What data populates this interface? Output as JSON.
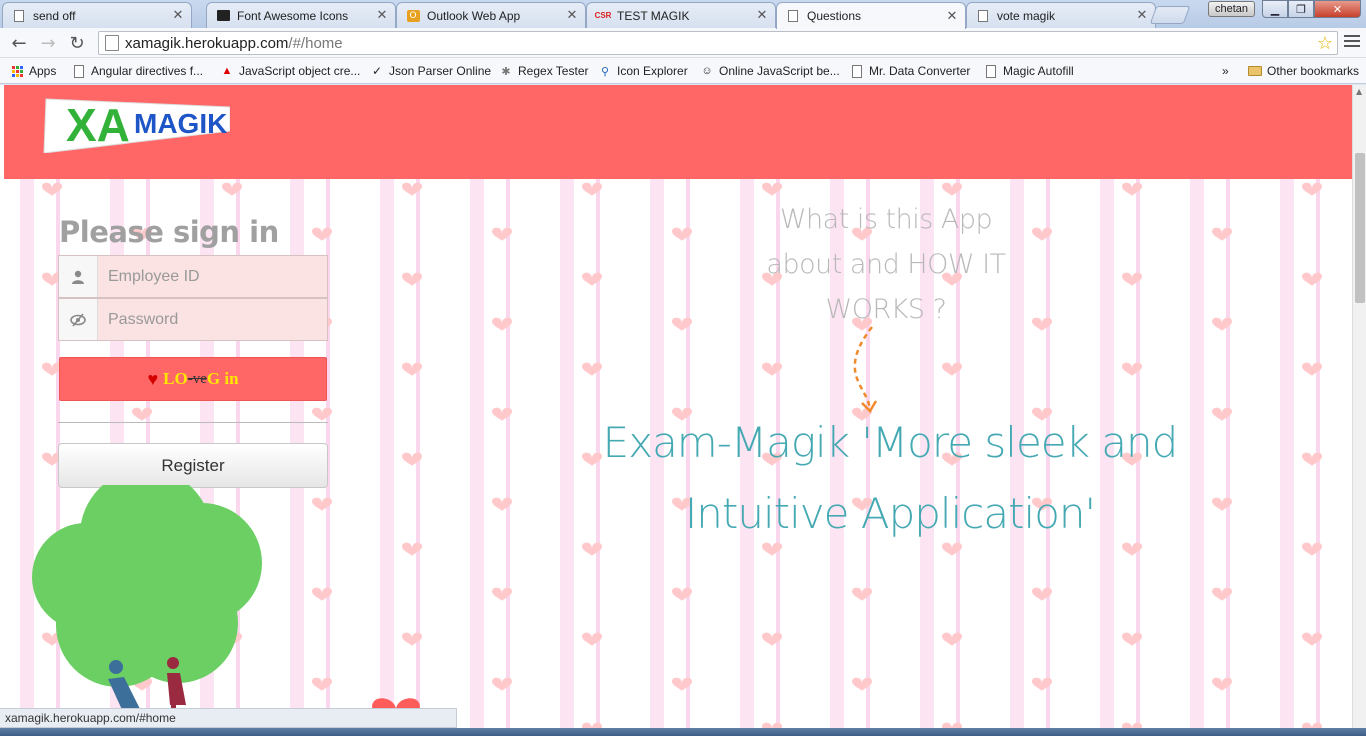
{
  "browser": {
    "tabs": [
      {
        "title": "send off",
        "active": false,
        "favicon": "page-icon"
      },
      {
        "title": "Font Awesome Icons",
        "active": false,
        "favicon": "flag-icon"
      },
      {
        "title": "Outlook Web App",
        "active": false,
        "favicon": "outlook-icon"
      },
      {
        "title": "TEST MAGIK",
        "active": false,
        "favicon": "csr-icon",
        "favicon_text": "CSR"
      },
      {
        "title": "Questions",
        "active": true,
        "favicon": "page-icon"
      },
      {
        "title": "vote magik",
        "active": false,
        "favicon": "page-icon"
      }
    ],
    "user": "chetan",
    "url_host": "xamagik.herokuapp.com",
    "url_rest": "/#/home",
    "bookmarks": [
      {
        "label": "Apps",
        "icon": "apps-grid-icon"
      },
      {
        "label": "Angular directives f...",
        "icon": "page-icon"
      },
      {
        "label": "JavaScript object cre...",
        "icon": "adobe-icon"
      },
      {
        "label": "Json Parser Online",
        "icon": "json-icon"
      },
      {
        "label": "Regex Tester",
        "icon": "regex-icon"
      },
      {
        "label": "Icon Explorer",
        "icon": "search-icon"
      },
      {
        "label": "Online JavaScript be...",
        "icon": "beautifier-icon"
      },
      {
        "label": "Mr. Data Converter",
        "icon": "page-icon"
      },
      {
        "label": "Magic Autofill",
        "icon": "page-icon"
      }
    ],
    "overflow": "»",
    "other_bookmarks": "Other bookmarks",
    "status_url": "xamagik.herokuapp.com/#home"
  },
  "site": {
    "logo": {
      "part1": "XA",
      "part2": "MAGIK"
    },
    "signin_title": "Please sign in",
    "employee_placeholder": "Employee ID",
    "password_placeholder": "Password",
    "login": {
      "a": "LO",
      "b": "-ve",
      "c": "G in"
    },
    "register_label": "Register",
    "question": "What is this App about and HOW IT WORKS ?",
    "tagline": "Exam-Magik 'More sleek and Intuitive Application'"
  },
  "colors": {
    "header": "#ff6666",
    "tagline": "#45a9b3",
    "question": "#b8b8b8",
    "tree": "#6ccf64"
  }
}
